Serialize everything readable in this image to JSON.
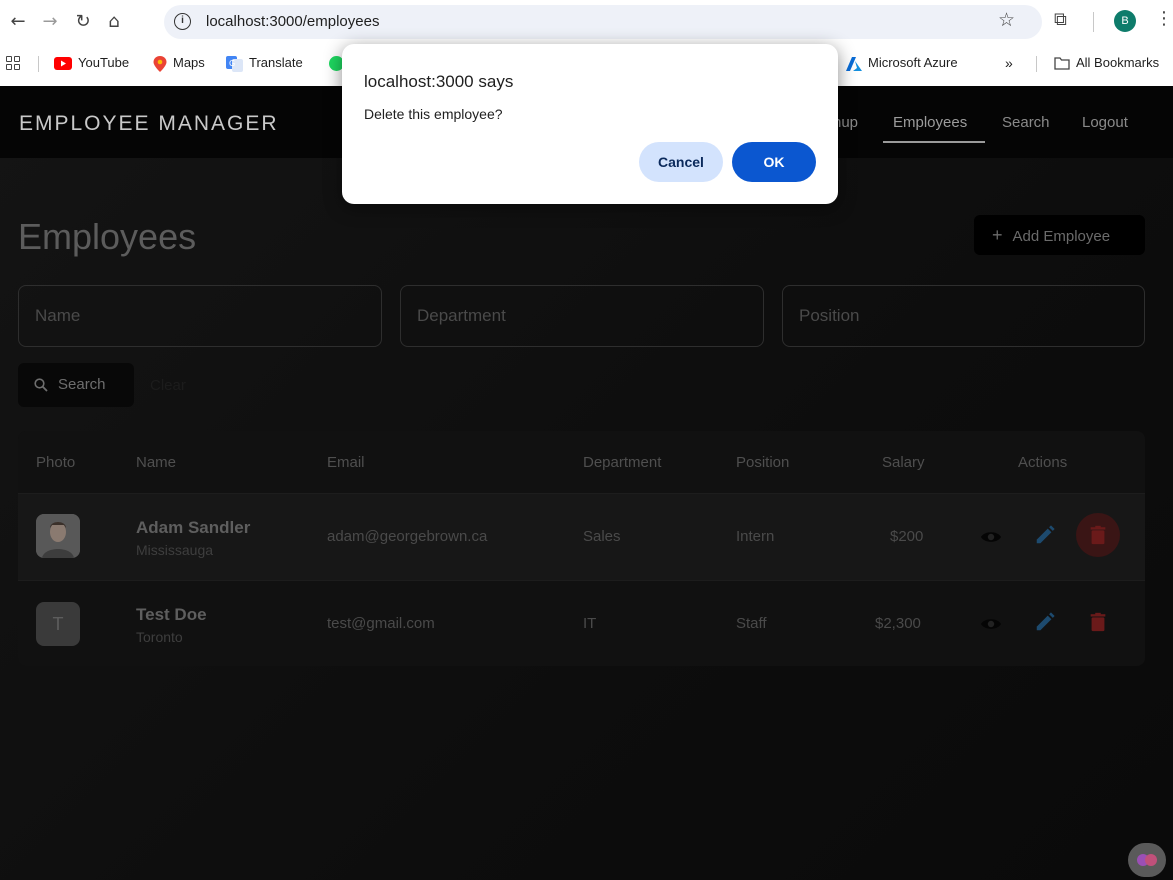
{
  "browser": {
    "url": "localhost:3000/employees",
    "profile_initial": "B",
    "bookmarks": [
      {
        "label": "YouTube",
        "icon": "youtube-icon"
      },
      {
        "label": "Maps",
        "icon": "maps-icon"
      },
      {
        "label": "Translate",
        "icon": "translate-icon"
      },
      {
        "label": "Microsoft Azure",
        "icon": "azure-icon"
      }
    ],
    "overflow_label": "»",
    "all_bookmarks_label": "All Bookmarks"
  },
  "app": {
    "brand": "EMPLOYEE MANAGER",
    "nav": {
      "signup_partial": "nup",
      "employees": "Employees",
      "search": "Search",
      "logout": "Logout"
    },
    "page_title": "Employees",
    "add_button": "Add Employee",
    "filters": {
      "name_placeholder": "Name",
      "department_placeholder": "Department",
      "position_placeholder": "Position"
    },
    "search_button": "Search",
    "clear_button": "Clear",
    "table": {
      "headers": {
        "photo": "Photo",
        "name": "Name",
        "email": "Email",
        "department": "Department",
        "position": "Position",
        "salary": "Salary",
        "actions": "Actions"
      },
      "rows": [
        {
          "name": "Adam Sandler",
          "city": "Mississauga",
          "email": "adam@georgebrown.ca",
          "department": "Sales",
          "position": "Intern",
          "salary": "$200",
          "initial": ""
        },
        {
          "name": "Test Doe",
          "city": "Toronto",
          "email": "test@gmail.com",
          "department": "IT",
          "position": "Staff",
          "salary": "$2,300",
          "initial": "T"
        }
      ]
    }
  },
  "dialog": {
    "title": "localhost:3000 says",
    "message": "Delete this employee?",
    "cancel": "Cancel",
    "ok": "OK"
  },
  "colors": {
    "ok_button": "#0b57d0",
    "cancel_button": "#d3e3fd",
    "edit_icon": "#1d4a6e",
    "delete_icon": "#6a1a1a"
  }
}
